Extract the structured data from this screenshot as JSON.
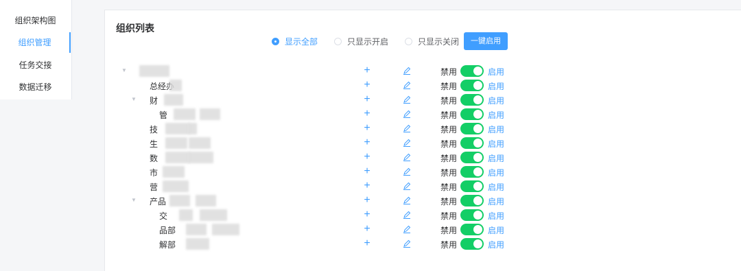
{
  "sidebar": {
    "items": [
      {
        "label": "组织架构图",
        "active": false
      },
      {
        "label": "组织管理",
        "active": true
      },
      {
        "label": "任务交接",
        "active": false
      },
      {
        "label": "数据迁移",
        "active": false
      }
    ]
  },
  "main": {
    "title": "组织列表",
    "filters": [
      {
        "label": "显示全部",
        "checked": true
      },
      {
        "label": "只显示开启",
        "checked": false
      },
      {
        "label": "只显示关闭",
        "checked": false
      }
    ],
    "enable_all_label": "一键启用",
    "row_labels": {
      "disable": "禁用",
      "enable": "启用"
    },
    "rows": [
      {
        "name": "",
        "level": 0,
        "expanded": true,
        "enabled": true
      },
      {
        "name": "总经办",
        "level": 1,
        "expanded": null,
        "enabled": true
      },
      {
        "name": "财",
        "level": 1,
        "expanded": true,
        "enabled": true
      },
      {
        "name": "管",
        "level": 2,
        "expanded": null,
        "enabled": true
      },
      {
        "name": "技",
        "level": 1,
        "expanded": null,
        "enabled": true
      },
      {
        "name": "生",
        "level": 1,
        "expanded": null,
        "enabled": true
      },
      {
        "name": "数",
        "level": 1,
        "expanded": null,
        "enabled": true
      },
      {
        "name": "市",
        "level": 1,
        "expanded": null,
        "enabled": true
      },
      {
        "name": "营",
        "level": 1,
        "expanded": null,
        "enabled": true
      },
      {
        "name": "产品",
        "level": 1,
        "expanded": true,
        "enabled": true
      },
      {
        "name": "交",
        "level": 2,
        "expanded": null,
        "enabled": true
      },
      {
        "name": "品部",
        "level": 2,
        "expanded": null,
        "enabled": true
      },
      {
        "name": "解部",
        "level": 2,
        "expanded": null,
        "enabled": true
      }
    ]
  },
  "colors": {
    "accent": "#409eff",
    "switch_on": "#13ce66"
  },
  "icons": {
    "add": "plus-icon",
    "edit": "pencil-icon",
    "caret": "caret-down-icon",
    "radio": "radio-dot-icon"
  }
}
